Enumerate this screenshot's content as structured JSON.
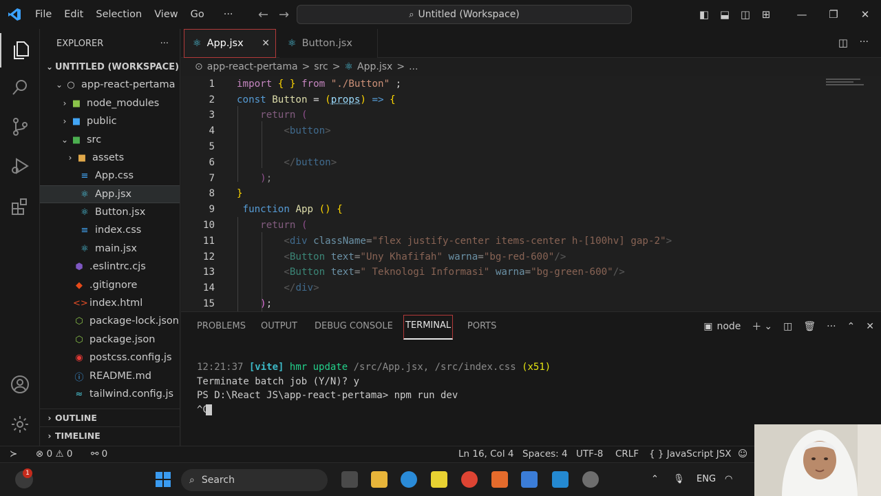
{
  "titlebar": {
    "menu": [
      "File",
      "Edit",
      "Selection",
      "View",
      "Go",
      "···"
    ],
    "command_center": "Untitled (Workspace)"
  },
  "sidebar": {
    "title": "EXPLORER",
    "more": "···",
    "workspace": "UNTITLED (WORKSPACE)",
    "project": "app-react-pertama",
    "items": [
      {
        "label": "node_modules",
        "type": "folder",
        "icon": "node-folder-icon"
      },
      {
        "label": "public",
        "type": "folder",
        "icon": "public-folder-icon"
      },
      {
        "label": "src",
        "type": "folder-open",
        "icon": "src-folder-icon"
      },
      {
        "label": "assets",
        "type": "folder",
        "icon": "assets-folder-icon"
      },
      {
        "label": "App.css",
        "type": "file",
        "icon": "css-file-icon"
      },
      {
        "label": "App.jsx",
        "type": "file",
        "icon": "react-file-icon"
      },
      {
        "label": "Button.jsx",
        "type": "file",
        "icon": "react-file-icon"
      },
      {
        "label": "index.css",
        "type": "file",
        "icon": "css-file-icon"
      },
      {
        "label": "main.jsx",
        "type": "file",
        "icon": "react-file-icon"
      },
      {
        "label": ".eslintrc.cjs",
        "type": "file",
        "icon": "eslint-file-icon"
      },
      {
        "label": ".gitignore",
        "type": "file",
        "icon": "git-file-icon"
      },
      {
        "label": "index.html",
        "type": "file",
        "icon": "html-file-icon"
      },
      {
        "label": "package-lock.json",
        "type": "file",
        "icon": "npm-file-icon"
      },
      {
        "label": "package.json",
        "type": "file",
        "icon": "npm-file-icon"
      },
      {
        "label": "postcss.config.js",
        "type": "file",
        "icon": "postcss-file-icon"
      },
      {
        "label": "README.md",
        "type": "file",
        "icon": "info-file-icon"
      },
      {
        "label": "tailwind.config.js",
        "type": "file",
        "icon": "tailwind-file-icon"
      }
    ],
    "outline": "OUTLINE",
    "timeline": "TIMELINE"
  },
  "tabs": [
    {
      "label": "App.jsx",
      "active": true
    },
    {
      "label": "Button.jsx",
      "active": false
    }
  ],
  "breadcrumb": [
    "app-react-pertama",
    ">",
    "src",
    ">",
    "App.jsx",
    ">",
    "..."
  ],
  "editor": {
    "line_numbers": [
      "1",
      "2",
      "3",
      "4",
      "5",
      "6",
      "7",
      "8",
      "9",
      "10",
      "11",
      "12",
      "13",
      "14",
      "15"
    ]
  },
  "panel": {
    "tabs": [
      "PROBLEMS",
      "OUTPUT",
      "DEBUG CONSOLE",
      "TERMINAL",
      "PORTS"
    ],
    "active_tab": "TERMINAL",
    "shell": "node",
    "terminal": {
      "time": "12:21:37",
      "vite": "[vite]",
      "hmr": "hmr update",
      "files": "/src/App.jsx, /src/index.css",
      "count": "(x51)",
      "line2": "Terminate batch job (Y/N)? y",
      "line3": "PS D:\\React JS\\app-react-pertama> npm run dev",
      "line4": "^C"
    }
  },
  "statusbar": {
    "errors": "0",
    "warnings": "0",
    "ports": "0",
    "position": "Ln 16, Col 4",
    "spaces": "Spaces: 4",
    "encoding": "UTF-8",
    "eol": "CRLF",
    "language": "JavaScript JSX"
  },
  "taskbar": {
    "search": "Search",
    "lang": "ENG",
    "badge": "1"
  }
}
